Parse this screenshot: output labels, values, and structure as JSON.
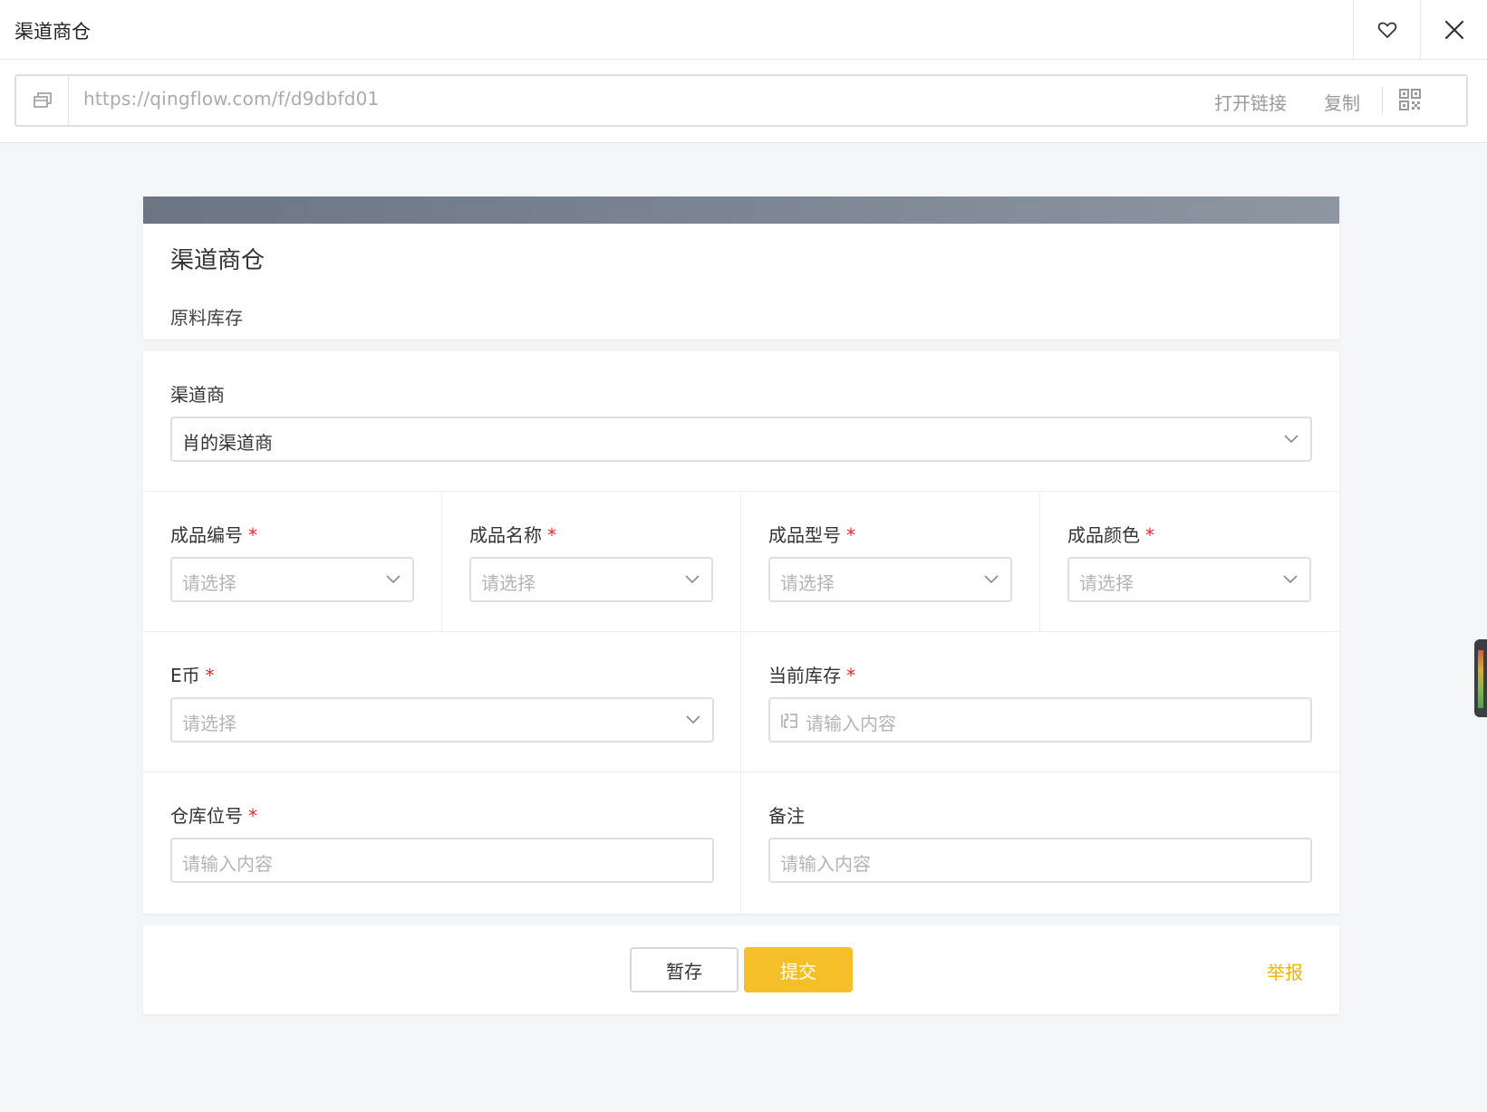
{
  "window": {
    "title": "渠道商仓",
    "favorite_icon": "heart-icon",
    "close_icon": "close-icon"
  },
  "link_bar": {
    "prefix_icon": "window-icon",
    "url": "https://qingflow.com/f/d9dbfd01",
    "open_label": "打开链接",
    "copy_label": "复制",
    "qr_icon": "qrcode-icon"
  },
  "form": {
    "title": "渠道商仓",
    "description": "原料库存",
    "fields": {
      "dealer": {
        "label": "渠道商",
        "value": "肖的渠道商",
        "required": false
      },
      "product_no": {
        "label": "成品编号",
        "placeholder": "请选择",
        "required": true
      },
      "product_name": {
        "label": "成品名称",
        "placeholder": "请选择",
        "required": true
      },
      "product_model": {
        "label": "成品型号",
        "placeholder": "请选择",
        "required": true
      },
      "product_color": {
        "label": "成品颜色",
        "placeholder": "请选择",
        "required": true
      },
      "e_coin": {
        "label": "E币",
        "placeholder": "请选择",
        "required": true
      },
      "current_stock": {
        "label": "当前库存",
        "placeholder": "请输入内容",
        "required": true
      },
      "location_no": {
        "label": "仓库位号",
        "placeholder": "请输入内容",
        "required": true
      },
      "remark": {
        "label": "备注",
        "placeholder": "请输入内容",
        "required": false
      }
    },
    "required_mark": "*"
  },
  "footer": {
    "save_label": "暂存",
    "submit_label": "提交",
    "report_label": "举报"
  },
  "colors": {
    "accent": "#f5bf2a",
    "report": "#f0b400",
    "required": "#f5222d",
    "banner": "#7c8593"
  }
}
